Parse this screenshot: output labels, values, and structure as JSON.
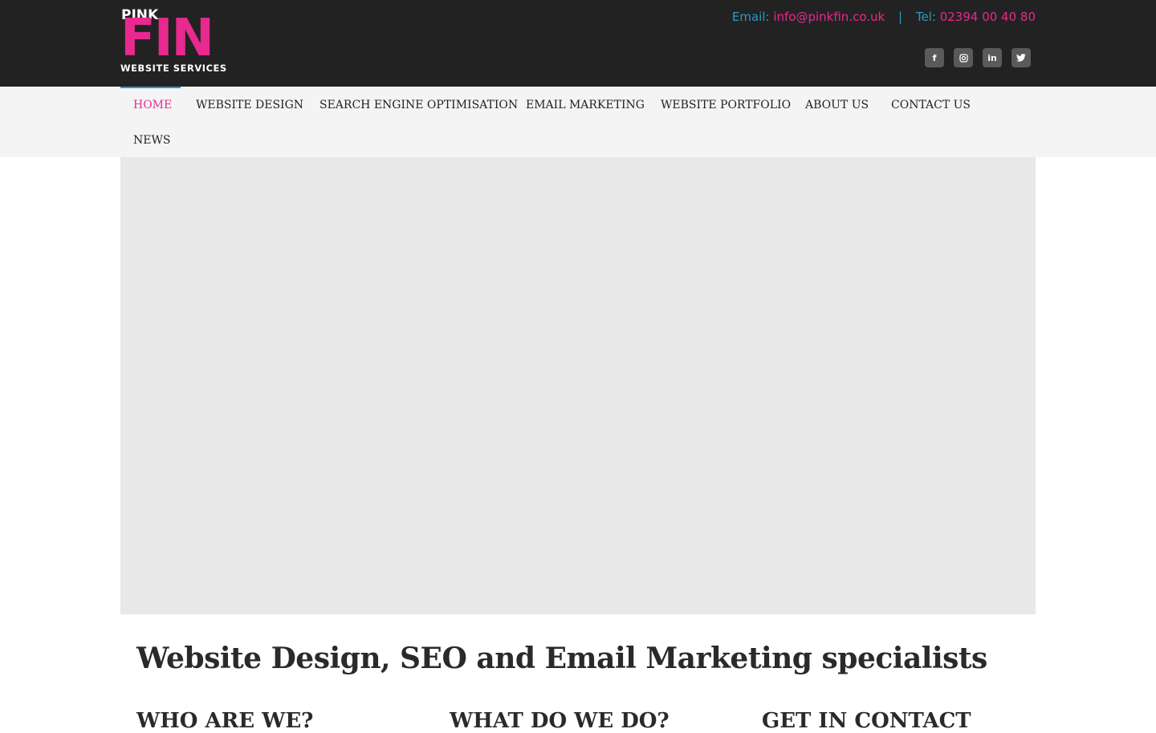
{
  "logo": {
    "line1": "PINK",
    "line2": "FIN",
    "line3": "WEBSITE SERVICES"
  },
  "contact": {
    "email_label": "Email:",
    "email": "info@pinkfin.co.uk",
    "separator": "|",
    "tel_label": "Tel:",
    "tel": "02394 00 40 80"
  },
  "socials": [
    {
      "icon": "facebook-icon",
      "glyph": "f"
    },
    {
      "icon": "instagram-icon",
      "glyph": ""
    },
    {
      "icon": "linkedin-icon",
      "glyph": "in"
    },
    {
      "icon": "twitter-icon",
      "glyph": ""
    }
  ],
  "nav": {
    "items": [
      {
        "label": "HOME",
        "active": true
      },
      {
        "label": "WEBSITE DESIGN"
      },
      {
        "label": "SEARCH ENGINE OPTIMISATION"
      },
      {
        "label": "EMAIL MARKETING"
      },
      {
        "label": "WEBSITE PORTFOLIO"
      },
      {
        "label": "ABOUT US"
      },
      {
        "label": "CONTACT US"
      },
      {
        "label": "NEWS"
      }
    ]
  },
  "main": {
    "headline": "Website Design, SEO and Email Marketing specialists",
    "columns": [
      {
        "title": "WHO ARE WE?"
      },
      {
        "title": "WHAT DO WE DO?"
      },
      {
        "title": "GET IN CONTACT"
      }
    ]
  },
  "colors": {
    "brand_pink": "#e8298f",
    "accent_blue": "#2a9bbf",
    "topbar_bg": "#222222",
    "nav_bg": "#f4f4f4",
    "hero_bg": "#e8e8e8"
  }
}
